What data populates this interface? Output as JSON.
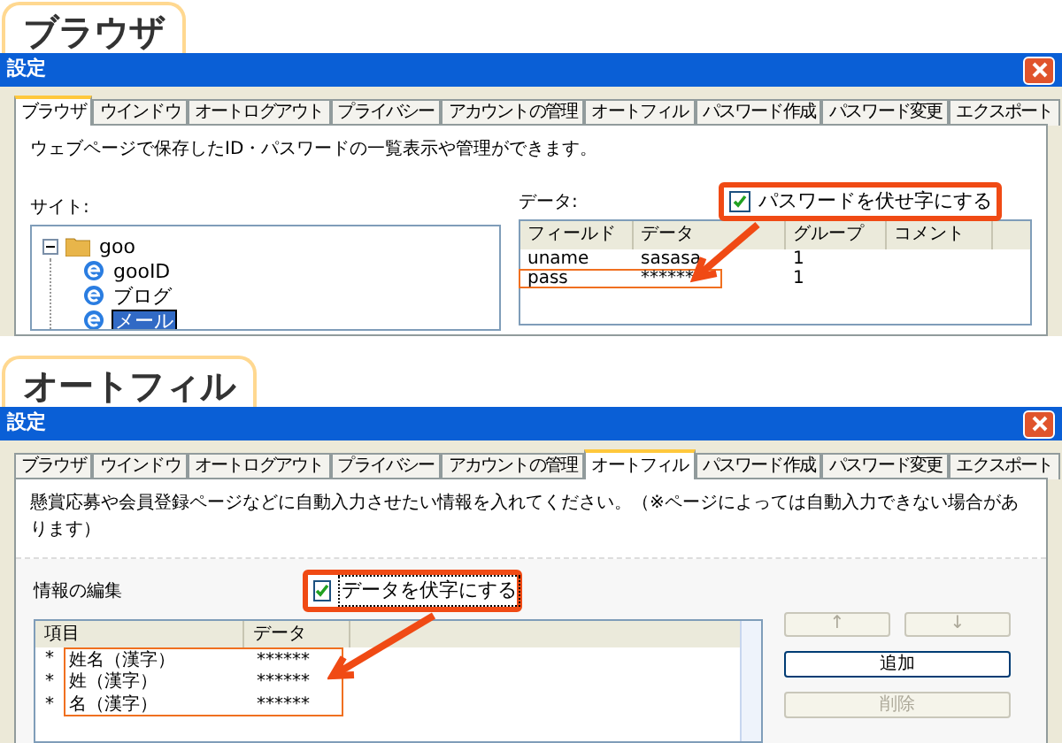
{
  "sections": [
    {
      "kind": "browser",
      "heading": "ブラウザ",
      "window": {
        "title": "設定"
      },
      "tabs": [
        {
          "label": "ブラウザ",
          "selected": true
        },
        {
          "label": "ウインドウ",
          "selected": false
        },
        {
          "label": "オートログアウト",
          "selected": false
        },
        {
          "label": "プライバシー",
          "selected": false
        },
        {
          "label": "アカウントの管理",
          "selected": false
        },
        {
          "label": "オートフィル",
          "selected": false
        },
        {
          "label": "パスワード作成",
          "selected": false
        },
        {
          "label": "パスワード変更",
          "selected": false
        },
        {
          "label": "エクスポート",
          "selected": false
        }
      ],
      "description": "ウェブページで保存したID・パスワードの一覧表示や管理ができます。",
      "site_label": "サイト:",
      "tree": [
        {
          "label": "goo",
          "expanded": true,
          "children": [
            {
              "label": "gooID",
              "selected": false
            },
            {
              "label": "ブログ",
              "selected": false
            },
            {
              "label": "メール",
              "selected": true
            }
          ]
        }
      ],
      "data_label": "データ:",
      "mask_checkbox": {
        "label": "パスワードを伏せ字にする",
        "checked": true
      },
      "table": {
        "columns": [
          "フィールド",
          "データ",
          "グループ",
          "コメント"
        ],
        "rows": [
          {
            "cells": [
              "uname",
              "sasasa",
              "1"
            ],
            "highlighted": false
          },
          {
            "cells": [
              "pass",
              "******",
              "1"
            ],
            "highlighted": true
          }
        ]
      }
    },
    {
      "kind": "autofill",
      "heading": "オートフィル",
      "window": {
        "title": "設定"
      },
      "tabs": [
        {
          "label": "ブラウザ",
          "selected": false
        },
        {
          "label": "ウインドウ",
          "selected": false
        },
        {
          "label": "オートログアウト",
          "selected": false
        },
        {
          "label": "プライバシー",
          "selected": false
        },
        {
          "label": "アカウントの管理",
          "selected": false
        },
        {
          "label": "オートフィル",
          "selected": true
        },
        {
          "label": "パスワード作成",
          "selected": false
        },
        {
          "label": "パスワード変更",
          "selected": false
        },
        {
          "label": "エクスポート",
          "selected": false
        }
      ],
      "description": "懸賞応募や会員登録ページなどに自動入力させたい情報を入れてください。（※ページによっては自動入力できない場合があります）",
      "edit_label": "情報の編集",
      "mask_checkbox": {
        "label": "データを伏字にする",
        "checked": true
      },
      "table": {
        "columns": [
          "項目",
          "データ"
        ],
        "rows": [
          {
            "mark": "*",
            "cells": [
              "姓名（漢字）",
              "******"
            ],
            "highlighted": true
          },
          {
            "mark": "*",
            "cells": [
              "姓（漢字）",
              "******"
            ],
            "highlighted": true
          },
          {
            "mark": "*",
            "cells": [
              "名（漢字）",
              "******"
            ],
            "highlighted": true
          }
        ]
      },
      "buttons": [
        {
          "label": "↑",
          "disabled": true
        },
        {
          "label": "↓",
          "disabled": true
        },
        {
          "label": "追加",
          "disabled": false
        },
        {
          "label": "削除",
          "disabled": true
        }
      ]
    }
  ]
}
